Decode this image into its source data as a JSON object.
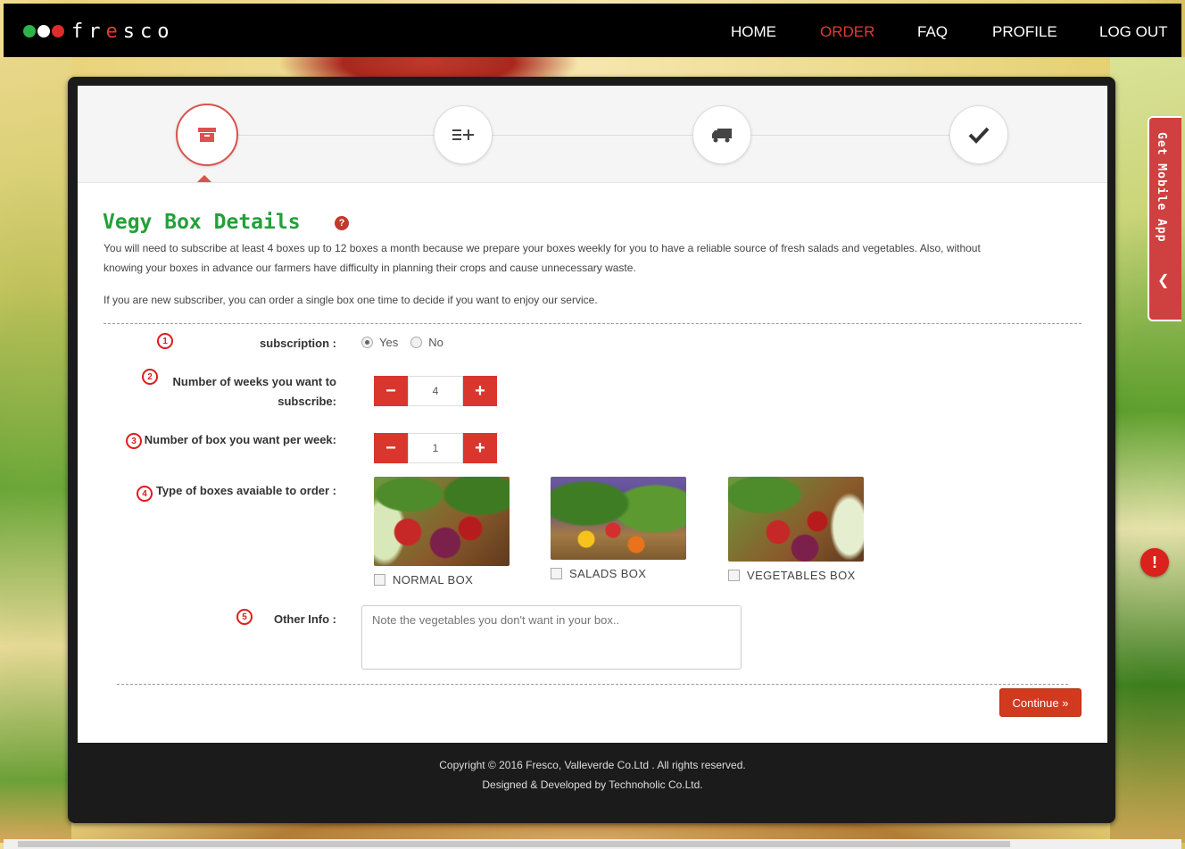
{
  "brand": {
    "name_prefix": "fr",
    "name_accent": "e",
    "name_suffix": "sco",
    "dot_colors": [
      "#2db34a",
      "#ffffff",
      "#e02b2b"
    ]
  },
  "nav": {
    "items": [
      {
        "label": "HOME",
        "active": false
      },
      {
        "label": "ORDER",
        "active": true
      },
      {
        "label": "FAQ",
        "active": false
      },
      {
        "label": "PROFILE",
        "active": false
      },
      {
        "label": "LOG OUT",
        "active": false
      }
    ]
  },
  "steps": [
    {
      "icon": "archive-box-icon",
      "active": true
    },
    {
      "icon": "list-add-icon",
      "active": false
    },
    {
      "icon": "truck-icon",
      "active": false
    },
    {
      "icon": "checkmark-icon",
      "active": false
    }
  ],
  "section": {
    "title": "Vegy Box Details",
    "help_icon": "question-circle-icon",
    "desc_line1": "You will need to subscribe at least 4 boxes up to 12 boxes a month because we prepare your boxes weekly for you to have a reliable source of fresh salads and vegetables. Also, without",
    "desc_line2": "knowing your boxes in advance our farmers have difficulty in planning their crops and cause unnecessary waste.",
    "desc_line3": "If you are new subscriber, you can order a single box one time to decide if you want to enjoy our service."
  },
  "form": {
    "subscription_label": "subscription :",
    "subscription_options": [
      "Yes",
      "No"
    ],
    "subscription_selected": "Yes",
    "weeks_label_1": "Number of weeks you want to",
    "weeks_label_2": "subscribe:",
    "weeks_value": "4",
    "box_label": "Number of box you want per week:",
    "box_value": "1",
    "minus": "−",
    "plus": "+",
    "types_label": "Type of boxes avaiable to order :",
    "box_types": [
      "NORMAL BOX",
      "SALADS BOX",
      "VEGETABLES BOX"
    ],
    "other_label": "Other Info :",
    "other_placeholder": "Note the vegetables you don't want in your box..",
    "continue_label": "Continue »"
  },
  "markers": [
    "1",
    "2",
    "3",
    "4",
    "5"
  ],
  "footer": {
    "copyright": "Copyright © 2016 Fresco, Valleverde Co.Ltd . All rights reserved.",
    "credits": "Designed & Developed by Technoholic Co.Ltd."
  },
  "side_tab": {
    "label": "Get Mobile App",
    "icon": "chevron-left-icon"
  },
  "alert": {
    "icon": "exclamation-icon",
    "text": "!"
  },
  "colors": {
    "accent_red": "#d9362e",
    "title_green": "#23a03a",
    "nav_active": "#e03b30"
  }
}
